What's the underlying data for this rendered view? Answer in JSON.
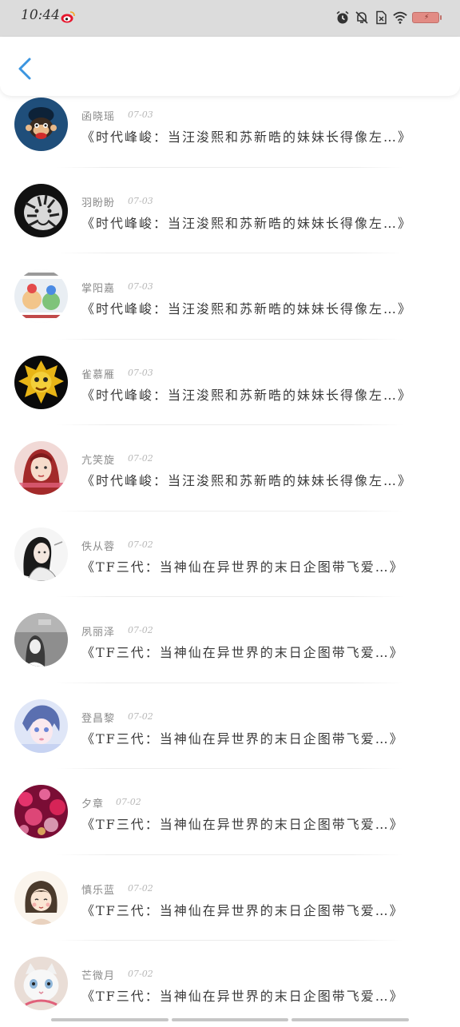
{
  "status_bar": {
    "time": "10:44",
    "icons": [
      "weibo-icon",
      "alarm-icon",
      "mute-icon",
      "sim-icon",
      "wifi-icon",
      "battery-icon"
    ]
  },
  "header": {
    "back_icon": "chevron-left-icon",
    "accent_color": "#3b95e0"
  },
  "comments": [
    {
      "user": "函晓瑶",
      "date": "07-03",
      "title": "《时代峰峻：当汪浚熙和苏新晧的妹妹长得像左…》",
      "avatar": "monkey-avatar"
    },
    {
      "user": "羽盼盼",
      "date": "07-03",
      "title": "《时代峰峻：当汪浚熙和苏新晧的妹妹长得像左…》",
      "avatar": "tiger-avatar"
    },
    {
      "user": "掌阳嘉",
      "date": "07-03",
      "title": "《时代峰峻：当汪浚熙和苏新晧的妹妹长得像左…》",
      "avatar": "toys-avatar"
    },
    {
      "user": "雀慕雁",
      "date": "07-03",
      "title": "《时代峰峻：当汪浚熙和苏新晧的妹妹长得像左…》",
      "avatar": "yellow-monster-avatar"
    },
    {
      "user": "亢笑旋",
      "date": "07-02",
      "title": "《时代峰峻：当汪浚熙和苏新晧的妹妹长得像左…》",
      "avatar": "girl-red-avatar"
    },
    {
      "user": "佚从蓉",
      "date": "07-02",
      "title": "《TF三代：当神仙在异世界的末日企图带飞爱…》",
      "avatar": "girl-sketch-avatar"
    },
    {
      "user": "夙丽泽",
      "date": "07-02",
      "title": "《TF三代：当神仙在异世界的末日企图带飞爱…》",
      "avatar": "girl-gray-avatar"
    },
    {
      "user": "登昌黎",
      "date": "07-02",
      "title": "《TF三代：当神仙在异世界的末日企图带飞爱…》",
      "avatar": "anime-blue-avatar"
    },
    {
      "user": "夕章",
      "date": "07-02",
      "title": "《TF三代：当神仙在异世界的末日企图带飞爱…》",
      "avatar": "pink-bokeh-avatar"
    },
    {
      "user": "慎乐蓝",
      "date": "07-02",
      "title": "《TF三代：当神仙在异世界的末日企图带飞爱…》",
      "avatar": "cartoon-girl-avatar"
    },
    {
      "user": "芒微月",
      "date": "07-02",
      "title": "《TF三代：当神仙在异世界的末日企图带飞爱…》",
      "avatar": "cat-avatar"
    }
  ]
}
